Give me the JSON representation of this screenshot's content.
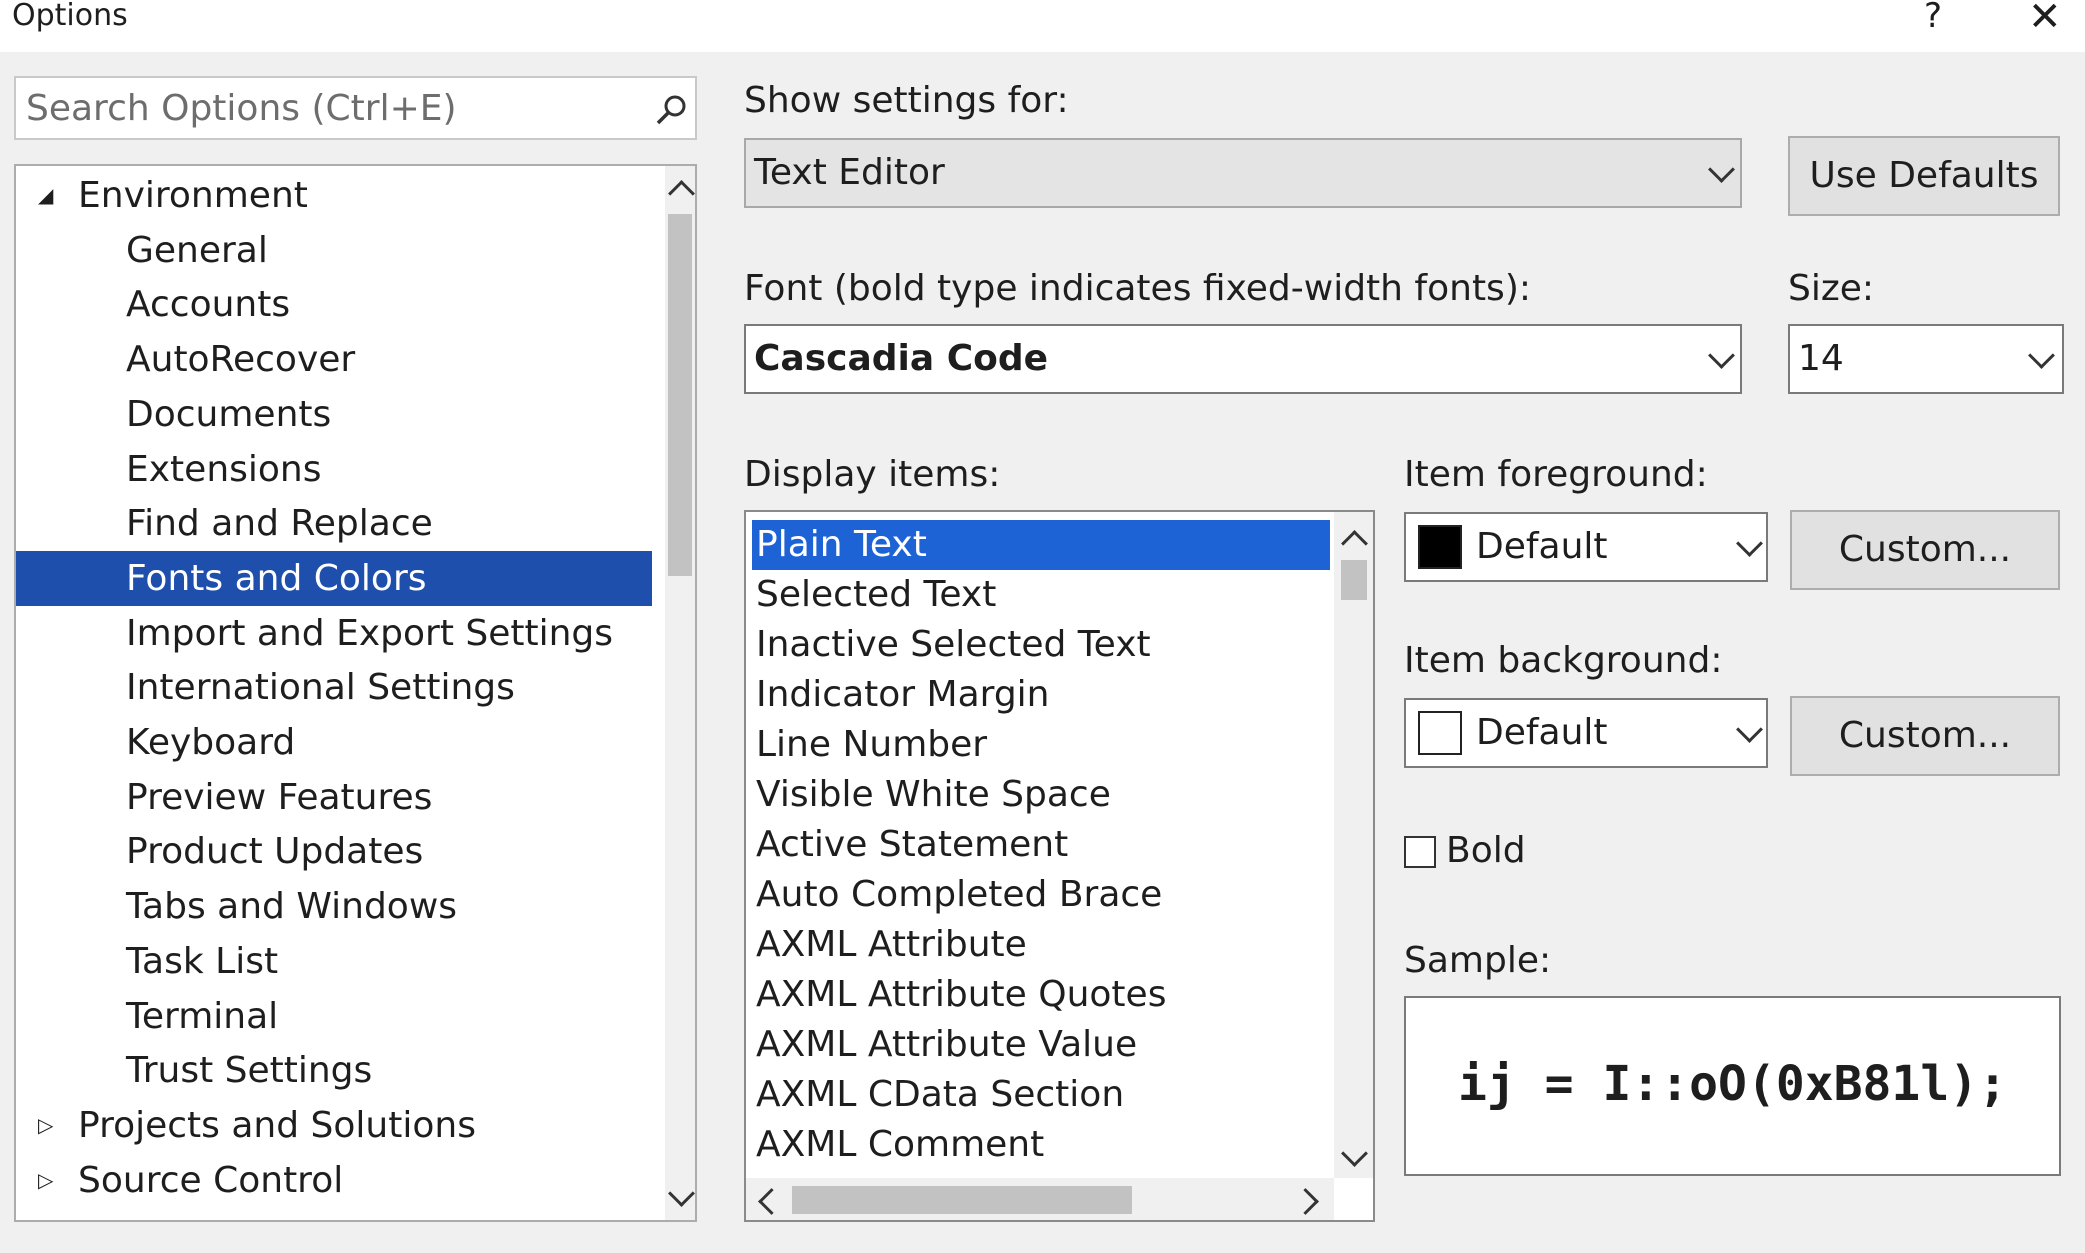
{
  "window": {
    "title": "Options",
    "help": "?",
    "close": "✕"
  },
  "search": {
    "placeholder": "Search Options (Ctrl+E)"
  },
  "tree": {
    "items": [
      {
        "label": "Environment",
        "level": 0,
        "expanded": true
      },
      {
        "label": "General",
        "level": 1
      },
      {
        "label": "Accounts",
        "level": 1
      },
      {
        "label": "AutoRecover",
        "level": 1
      },
      {
        "label": "Documents",
        "level": 1
      },
      {
        "label": "Extensions",
        "level": 1
      },
      {
        "label": "Find and Replace",
        "level": 1
      },
      {
        "label": "Fonts and Colors",
        "level": 1,
        "selected": true
      },
      {
        "label": "Import and Export Settings",
        "level": 1
      },
      {
        "label": "International Settings",
        "level": 1
      },
      {
        "label": "Keyboard",
        "level": 1
      },
      {
        "label": "Preview Features",
        "level": 1
      },
      {
        "label": "Product Updates",
        "level": 1
      },
      {
        "label": "Tabs and Windows",
        "level": 1
      },
      {
        "label": "Task List",
        "level": 1
      },
      {
        "label": "Terminal",
        "level": 1
      },
      {
        "label": "Trust Settings",
        "level": 1
      },
      {
        "label": "Projects and Solutions",
        "level": 0,
        "expanded": false
      },
      {
        "label": "Source Control",
        "level": 0,
        "expanded": false
      }
    ]
  },
  "show_settings": {
    "label": "Show settings for:",
    "value": "Text Editor"
  },
  "use_defaults": "Use Defaults",
  "font": {
    "label": "Font (bold type indicates fixed-width fonts):",
    "value": "Cascadia Code"
  },
  "size": {
    "label": "Size:",
    "value": "14"
  },
  "display_items": {
    "label": "Display items:",
    "items": [
      "Plain Text",
      "Selected Text",
      "Inactive Selected Text",
      "Indicator Margin",
      "Line Number",
      "Visible White Space",
      "Active Statement",
      "Auto Completed Brace",
      "AXML Attribute",
      "AXML Attribute Quotes",
      "AXML Attribute Value",
      "AXML CData Section",
      "AXML Comment"
    ],
    "selected_index": 0
  },
  "foreground": {
    "label": "Item foreground:",
    "value": "Default",
    "swatch_color": "#000000",
    "custom": "Custom..."
  },
  "background": {
    "label": "Item background:",
    "value": "Default",
    "swatch_color": "#ffffff",
    "custom": "Custom..."
  },
  "bold": {
    "label": "Bold",
    "checked": false
  },
  "sample": {
    "label": "Sample:",
    "text": "ij = I::oO(0xB81l);"
  },
  "colors": {
    "accent": "#1e4fad",
    "list_selection": "#1e63d6"
  }
}
